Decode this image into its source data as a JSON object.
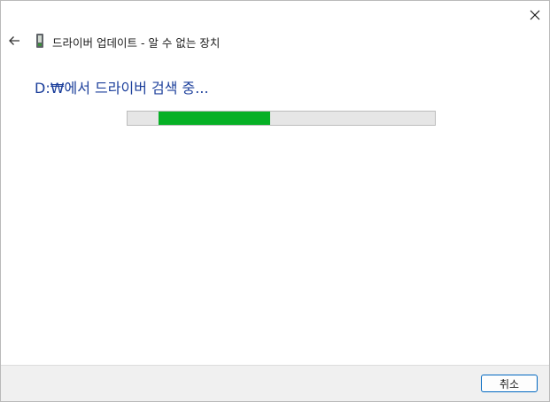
{
  "window": {
    "title": "드라이버 업데이트 - 알 수 없는 장치"
  },
  "status": {
    "message": "D:₩에서 드라이버 검색 중..."
  },
  "progress": {
    "segment_start_percent": 10,
    "segment_end_percent": 46.5,
    "fill_color": "#06b025",
    "track_color": "#e6e6e6"
  },
  "footer": {
    "cancel_label": "취소"
  },
  "icons": {
    "close": "close-icon",
    "back": "back-arrow-icon",
    "device": "device-icon"
  },
  "colors": {
    "status_text": "#1c3f9b",
    "button_border": "#0067c0"
  }
}
